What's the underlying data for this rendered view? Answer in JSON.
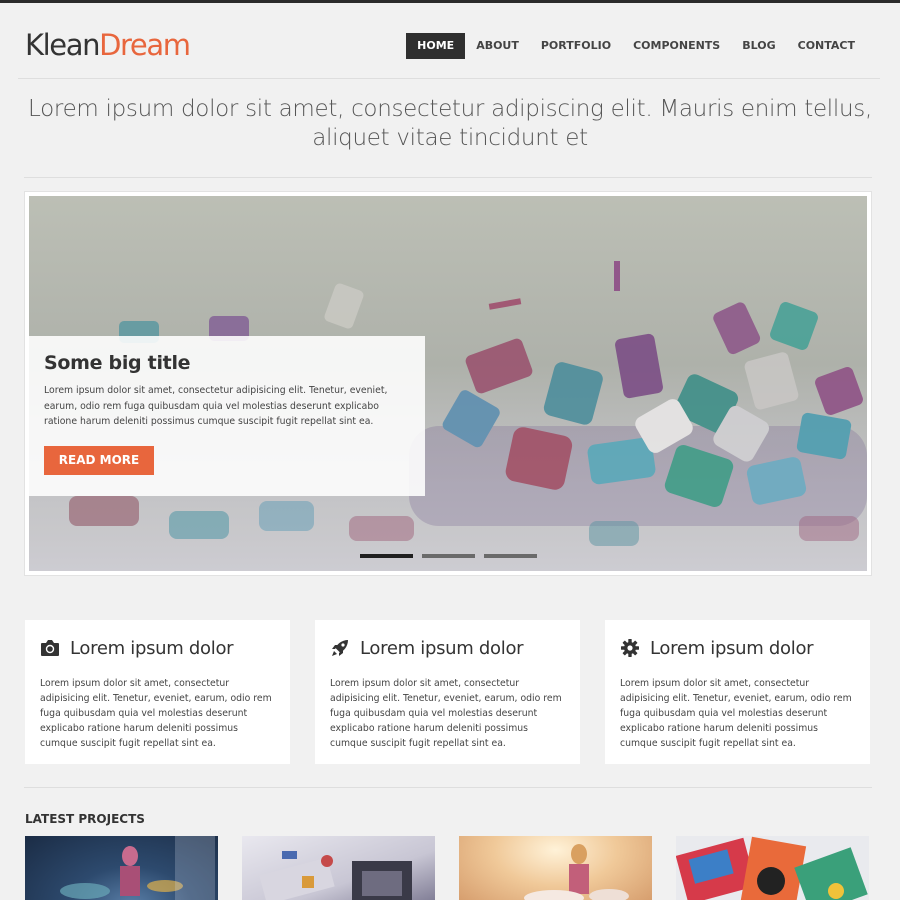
{
  "brand": {
    "part1": "Klean",
    "part2": "Dream",
    "accent": "#e8663d"
  },
  "nav": [
    "HOME",
    "ABOUT",
    "PORTFOLIO",
    "COMPONENTS",
    "BLOG",
    "CONTACT"
  ],
  "tagline": "Lorem ipsum dolor sit amet, consectetur adipiscing elit. Mauris enim tellus, aliquet vitae tincidunt et",
  "slider": {
    "title": "Some big title",
    "text": "Lorem ipsum dolor sit amet, consectetur adipisicing elit. Tenetur, eveniet, earum, odio rem fuga quibusdam quia vel molestias deserunt explicabo ratione harum deleniti possimus cumque suscipit fugit repellat sint ea.",
    "button": "READ MORE",
    "slide_count": 3,
    "active_slide": 1
  },
  "features": [
    {
      "icon": "camera-icon",
      "title": "Lorem ipsum dolor",
      "text": "Lorem ipsum dolor sit amet, consectetur adipisicing elit. Tenetur, eveniet, earum, odio rem fuga quibusdam quia vel molestias deserunt explicabo ratione harum deleniti possimus cumque suscipit fugit repellat sint ea."
    },
    {
      "icon": "rocket-icon",
      "title": "Lorem ipsum dolor",
      "text": "Lorem ipsum dolor sit amet, consectetur adipisicing elit. Tenetur, eveniet, earum, odio rem fuga quibusdam quia vel molestias deserunt explicabo ratione harum deleniti possimus cumque suscipit fugit repellat sint ea."
    },
    {
      "icon": "gear-icon",
      "title": "Lorem ipsum dolor",
      "text": "Lorem ipsum dolor sit amet, consectetur adipisicing elit. Tenetur, eveniet, earum, odio rem fuga quibusdam quia vel molestias deserunt explicabo ratione harum deleniti possimus cumque suscipit fugit repellat sint ea."
    }
  ],
  "projects": {
    "title": "LATEST PROJECTS"
  }
}
